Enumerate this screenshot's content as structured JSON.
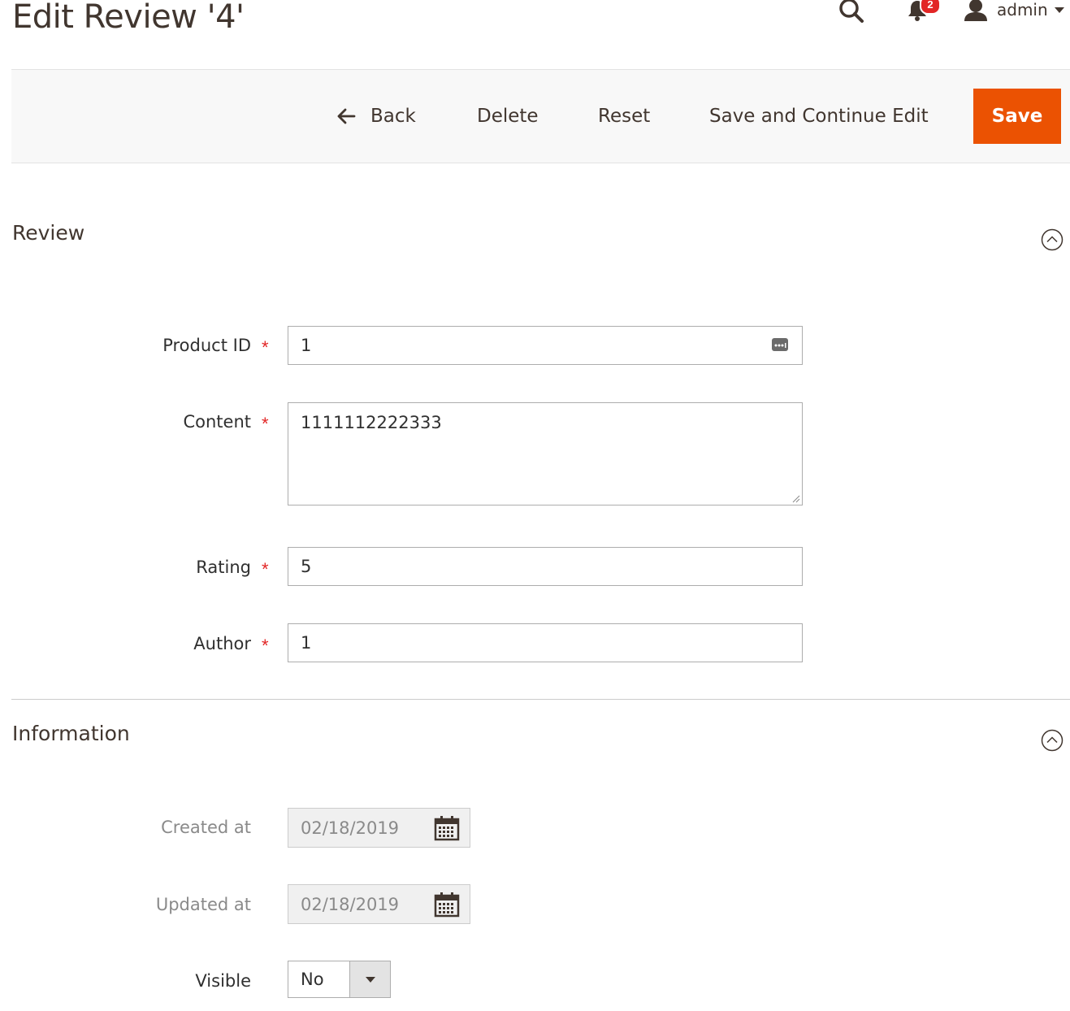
{
  "page": {
    "title": "Edit Review '4'"
  },
  "header": {
    "notifications_count": "2",
    "user_name": "admin",
    "icons": [
      "search-icon",
      "bell-icon",
      "user-icon",
      "chevron-down-icon"
    ]
  },
  "toolbar": {
    "back_label": "Back",
    "delete_label": "Delete",
    "reset_label": "Reset",
    "save_continue_label": "Save and Continue Edit",
    "save_label": "Save",
    "save_color": "#eb5202"
  },
  "review_section": {
    "title": "Review",
    "fields": {
      "product_id": {
        "label": "Product ID",
        "value": "1",
        "required": "*"
      },
      "content": {
        "label": "Content",
        "value": "1111112222333",
        "required": "*"
      },
      "rating": {
        "label": "Rating",
        "value": "5",
        "required": "*"
      },
      "author": {
        "label": "Author",
        "value": "1",
        "required": "*"
      }
    }
  },
  "information_section": {
    "title": "Information",
    "fields": {
      "created_at": {
        "label": "Created at",
        "value": "02/18/2019"
      },
      "updated_at": {
        "label": "Updated at",
        "value": "02/18/2019"
      },
      "visible": {
        "label": "Visible",
        "value": "No"
      }
    }
  }
}
